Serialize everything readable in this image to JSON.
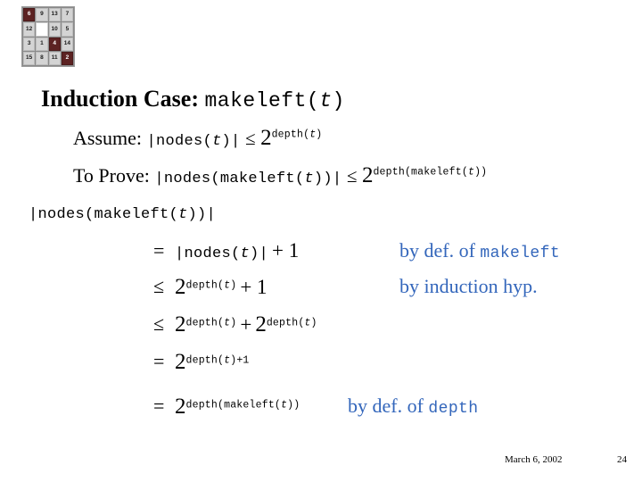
{
  "puzzle": {
    "rows": [
      [
        {
          "v": "6",
          "style": "dark"
        },
        {
          "v": "9",
          "style": "light"
        },
        {
          "v": "13",
          "style": "light"
        },
        {
          "v": "7",
          "style": "light"
        }
      ],
      [
        {
          "v": "12",
          "style": "light"
        },
        {
          "v": "",
          "style": "blank"
        },
        {
          "v": "10",
          "style": "light"
        },
        {
          "v": "5",
          "style": "light"
        }
      ],
      [
        {
          "v": "3",
          "style": "light"
        },
        {
          "v": "1",
          "style": "light"
        },
        {
          "v": "4",
          "style": "dark"
        },
        {
          "v": "14",
          "style": "light"
        }
      ],
      [
        {
          "v": "15",
          "style": "light"
        },
        {
          "v": "8",
          "style": "light"
        },
        {
          "v": "11",
          "style": "light"
        },
        {
          "v": "2",
          "style": "dark"
        }
      ]
    ],
    "colors": {
      "dark_cell": "#5C2222",
      "light_cell": "#D4D4D4",
      "blank_cell": "#FFFFFF",
      "grid_border": "#8A8A8A"
    }
  },
  "title": {
    "lead": "Induction Case:",
    "code_prefix": "makeleft(",
    "code_var": "t",
    "code_suffix": ")"
  },
  "assume": {
    "label": "Assume:",
    "lhs_prefix": "|nodes(",
    "lhs_var": "t",
    "lhs_suffix": ")|",
    "relation": "≤",
    "base": "2",
    "exp_prefix": "depth(",
    "exp_var": "t",
    "exp_suffix": ")"
  },
  "prove": {
    "label": "To Prove:",
    "lhs_prefix": "|nodes(makeleft(",
    "lhs_var": "t",
    "lhs_suffix": "))|",
    "relation": "≤",
    "base": "2",
    "exp_prefix": "depth(makeleft(",
    "exp_var": "t",
    "exp_suffix": "))"
  },
  "head_expr": {
    "prefix": "|nodes(makeleft(",
    "var": "t",
    "suffix": "))|"
  },
  "derivation": [
    {
      "relation": "=",
      "term_prefix": "|nodes(",
      "term_var": "t",
      "term_suffix": ")|",
      "plus": "+ 1",
      "justification_text": "by def. of ",
      "justification_code": "makeleft"
    },
    {
      "relation": "≤",
      "base": "2",
      "exp_prefix": "depth(",
      "exp_var": "t",
      "exp_suffix": ")",
      "plus": "+ 1",
      "justification_text": "by induction hyp.",
      "justification_code": ""
    },
    {
      "relation": "≤",
      "base": "2",
      "exp_prefix": "depth(",
      "exp_var": "t",
      "exp_suffix": ")",
      "plus": "+",
      "base2": "2",
      "exp2_prefix": "depth(",
      "exp2_var": "t",
      "exp2_suffix": ")",
      "justification_text": "",
      "justification_code": ""
    },
    {
      "relation": "=",
      "base": "2",
      "exp_prefix": "depth(",
      "exp_var": "t",
      "exp_suffix": ")+1",
      "justification_text": "",
      "justification_code": ""
    },
    {
      "relation": "=",
      "base": "2",
      "exp_prefix": "depth(makeleft(",
      "exp_var": "t",
      "exp_suffix": "))",
      "justification_text": "by def. of ",
      "justification_code": "depth"
    }
  ],
  "footer": {
    "date": "March 6, 2002",
    "page": "24"
  },
  "colors": {
    "justification_blue": "#3366BB",
    "text_black": "#000000",
    "background": "#FFFFFF"
  }
}
